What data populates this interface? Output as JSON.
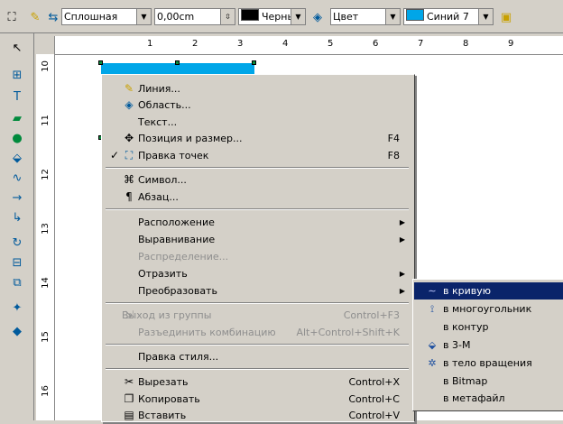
{
  "toolbar": {
    "icons": [
      "select-arrow-tool-icon",
      "line-icon",
      "line-style-icon",
      "line-color-icon",
      "area-fill-icon",
      "shadow-icon"
    ],
    "line_style": "Сплошная",
    "line_width": "0,00cm",
    "line_color": "Черный",
    "line_color_hex": "#000000",
    "area_style": "Цвет",
    "area_color": "Синий 7",
    "area_color_hex": "#00a6e8"
  },
  "ruler": {
    "h_numbers": [
      "1",
      "2",
      "3",
      "4",
      "5",
      "6",
      "7",
      "8",
      "9"
    ],
    "v_numbers": [
      "10",
      "11",
      "12",
      "13",
      "14",
      "15",
      "16"
    ]
  },
  "context_menu": {
    "items": [
      {
        "icon": "line-icon",
        "label": "Линия...",
        "underline": ""
      },
      {
        "icon": "area-icon",
        "label": "Область...",
        "underline": ""
      },
      {
        "icon": "",
        "label": "Текст...",
        "underline": ""
      },
      {
        "icon": "position-icon",
        "label": "Позиция и размер...",
        "shortcut": "F4"
      },
      {
        "icon": "points-icon",
        "label": "Правка точек",
        "shortcut": "F8",
        "checked": true
      },
      {
        "icon": "character-icon",
        "label": "Символ..."
      },
      {
        "icon": "paragraph-icon",
        "label": "Абзац..."
      },
      {
        "label": "Расположение",
        "submenu": true
      },
      {
        "label": "Выравнивание",
        "submenu": true
      },
      {
        "label": "Распределение...",
        "disabled": true
      },
      {
        "label": "Отразить",
        "submenu": true
      },
      {
        "label": "Преобразовать",
        "submenu": true
      },
      {
        "icon": "exit-group-icon",
        "label": "Выход из группы",
        "shortcut": "Control+F3",
        "disabled": true
      },
      {
        "label": "Разъединить комбинацию",
        "shortcut": "Alt+Control+Shift+K",
        "disabled": true
      },
      {
        "label": "Правка стиля..."
      },
      {
        "icon": "cut-icon",
        "label": "Вырезать",
        "shortcut": "Control+X"
      },
      {
        "icon": "copy-icon",
        "label": "Копировать",
        "shortcut": "Control+C"
      },
      {
        "icon": "paste-icon",
        "label": "Вставить",
        "shortcut": "Control+V"
      }
    ]
  },
  "submenu": {
    "items": [
      {
        "label": "в кривую",
        "highlighted": true
      },
      {
        "label": "в многоугольник"
      },
      {
        "label": "в контур"
      },
      {
        "label": "в 3-М"
      },
      {
        "label": "в тело вращения"
      },
      {
        "label": "в Bitmap"
      },
      {
        "label": "в метафайл"
      }
    ]
  }
}
